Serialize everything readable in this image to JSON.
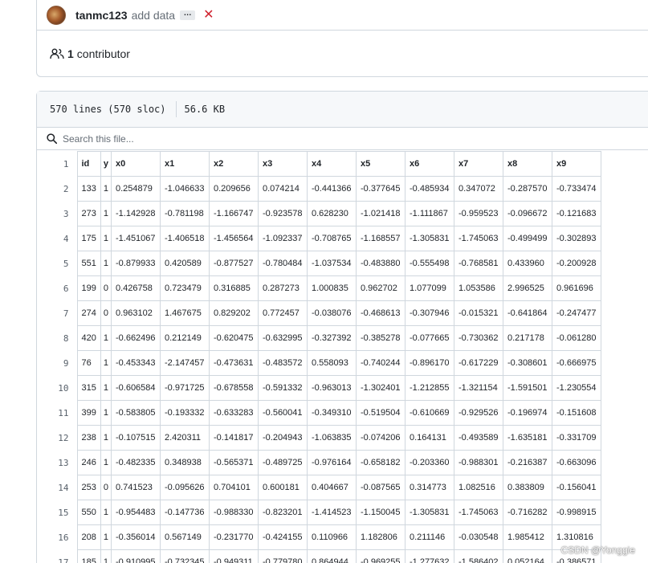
{
  "commit": {
    "author": "tanmc123",
    "message": "add data",
    "ellipsis": "…",
    "status_icon": "x-icon",
    "status_color": "#cf222e"
  },
  "contributors": {
    "count": "1",
    "label": "contributor"
  },
  "file": {
    "lines": "570 lines (570 sloc)",
    "size": "56.6 KB"
  },
  "search": {
    "placeholder": "Search this file..."
  },
  "table": {
    "headers": [
      "id",
      "y",
      "x0",
      "x1",
      "x2",
      "x3",
      "x4",
      "x5",
      "x6",
      "x7",
      "x8",
      "x9"
    ],
    "rows": [
      {
        "ln": "2",
        "cells": [
          "133",
          "1",
          "0.254879",
          "-1.046633",
          "0.209656",
          "0.074214",
          "-0.441366",
          "-0.377645",
          "-0.485934",
          "0.347072",
          "-0.287570",
          "-0.733474"
        ]
      },
      {
        "ln": "3",
        "cells": [
          "273",
          "1",
          "-1.142928",
          "-0.781198",
          "-1.166747",
          "-0.923578",
          "0.628230",
          "-1.021418",
          "-1.111867",
          "-0.959523",
          "-0.096672",
          "-0.121683"
        ]
      },
      {
        "ln": "4",
        "cells": [
          "175",
          "1",
          "-1.451067",
          "-1.406518",
          "-1.456564",
          "-1.092337",
          "-0.708765",
          "-1.168557",
          "-1.305831",
          "-1.745063",
          "-0.499499",
          "-0.302893"
        ]
      },
      {
        "ln": "5",
        "cells": [
          "551",
          "1",
          "-0.879933",
          "0.420589",
          "-0.877527",
          "-0.780484",
          "-1.037534",
          "-0.483880",
          "-0.555498",
          "-0.768581",
          "0.433960",
          "-0.200928"
        ]
      },
      {
        "ln": "6",
        "cells": [
          "199",
          "0",
          "0.426758",
          "0.723479",
          "0.316885",
          "0.287273",
          "1.000835",
          "0.962702",
          "1.077099",
          "1.053586",
          "2.996525",
          "0.961696"
        ]
      },
      {
        "ln": "7",
        "cells": [
          "274",
          "0",
          "0.963102",
          "1.467675",
          "0.829202",
          "0.772457",
          "-0.038076",
          "-0.468613",
          "-0.307946",
          "-0.015321",
          "-0.641864",
          "-0.247477"
        ]
      },
      {
        "ln": "8",
        "cells": [
          "420",
          "1",
          "-0.662496",
          "0.212149",
          "-0.620475",
          "-0.632995",
          "-0.327392",
          "-0.385278",
          "-0.077665",
          "-0.730362",
          "0.217178",
          "-0.061280"
        ]
      },
      {
        "ln": "9",
        "cells": [
          "76",
          "1",
          "-0.453343",
          "-2.147457",
          "-0.473631",
          "-0.483572",
          "0.558093",
          "-0.740244",
          "-0.896170",
          "-0.617229",
          "-0.308601",
          "-0.666975"
        ]
      },
      {
        "ln": "10",
        "cells": [
          "315",
          "1",
          "-0.606584",
          "-0.971725",
          "-0.678558",
          "-0.591332",
          "-0.963013",
          "-1.302401",
          "-1.212855",
          "-1.321154",
          "-1.591501",
          "-1.230554"
        ]
      },
      {
        "ln": "11",
        "cells": [
          "399",
          "1",
          "-0.583805",
          "-0.193332",
          "-0.633283",
          "-0.560041",
          "-0.349310",
          "-0.519504",
          "-0.610669",
          "-0.929526",
          "-0.196974",
          "-0.151608"
        ]
      },
      {
        "ln": "12",
        "cells": [
          "238",
          "1",
          "-0.107515",
          "2.420311",
          "-0.141817",
          "-0.204943",
          "-1.063835",
          "-0.074206",
          "0.164131",
          "-0.493589",
          "-1.635181",
          "-0.331709"
        ]
      },
      {
        "ln": "13",
        "cells": [
          "246",
          "1",
          "-0.482335",
          "0.348938",
          "-0.565371",
          "-0.489725",
          "-0.976164",
          "-0.658182",
          "-0.203360",
          "-0.988301",
          "-0.216387",
          "-0.663096"
        ]
      },
      {
        "ln": "14",
        "cells": [
          "253",
          "0",
          "0.741523",
          "-0.095626",
          "0.704101",
          "0.600181",
          "0.404667",
          "-0.087565",
          "0.314773",
          "1.082516",
          "0.383809",
          "-0.156041"
        ]
      },
      {
        "ln": "15",
        "cells": [
          "550",
          "1",
          "-0.954483",
          "-0.147736",
          "-0.988330",
          "-0.823201",
          "-1.414523",
          "-1.150045",
          "-1.305831",
          "-1.745063",
          "-0.716282",
          "-0.998915"
        ]
      },
      {
        "ln": "16",
        "cells": [
          "208",
          "1",
          "-0.356014",
          "0.567149",
          "-0.231770",
          "-0.424155",
          "0.110966",
          "1.182806",
          "0.211146",
          "-0.030548",
          "1.985412",
          "1.310816"
        ]
      },
      {
        "ln": "17",
        "cells": [
          "185",
          "1",
          "-0.910995",
          "-0.732345",
          "-0.949311",
          "-0.779780",
          "0.864944",
          "-0.969255",
          "-1.277632",
          "-1.586402",
          "0.052164",
          "-0.386571"
        ]
      }
    ],
    "header_ln": "1"
  },
  "watermark": "CSDN @Yonggie"
}
